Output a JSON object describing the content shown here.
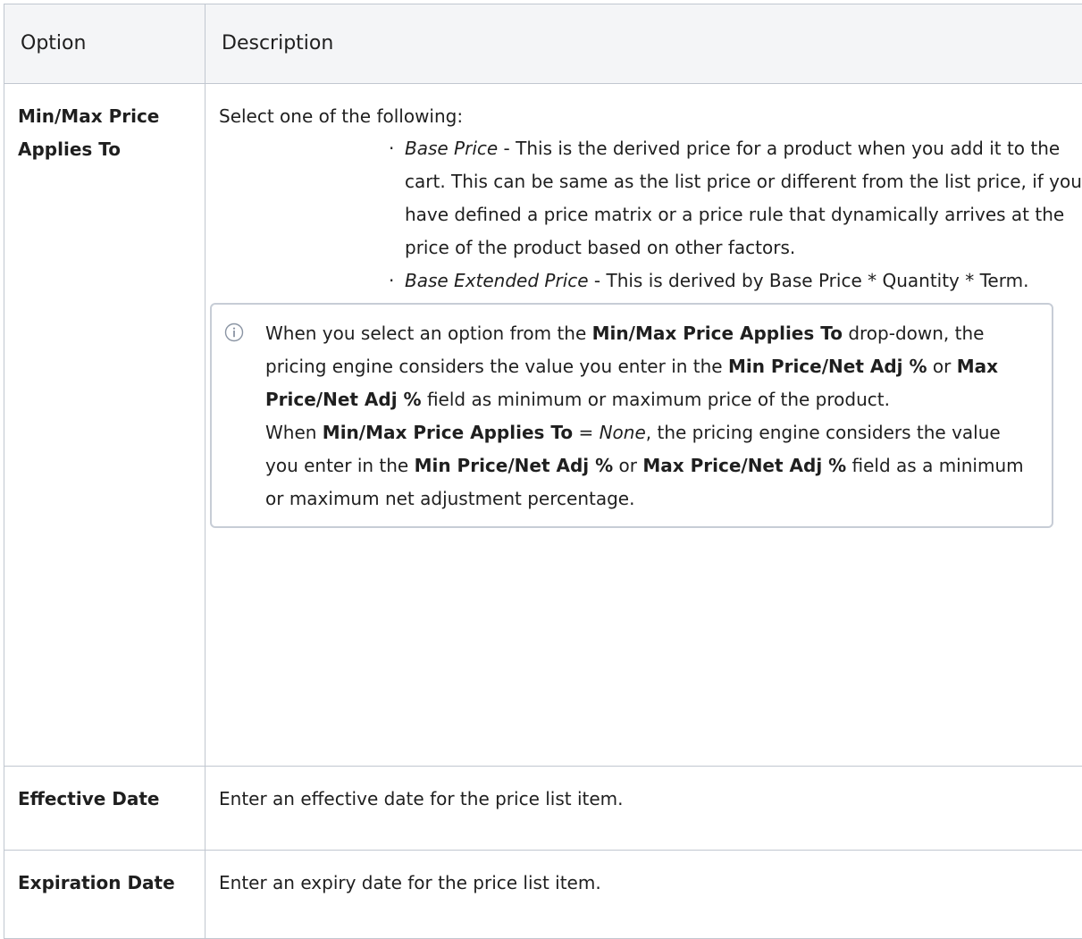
{
  "table": {
    "headers": [
      "Option",
      "Description"
    ],
    "rows": {
      "min_max": {
        "option": "Min/Max Price Applies To",
        "intro": "Select one of the following:",
        "bullets": [
          {
            "term": "Base Price",
            "text": " - This is the derived price for a product when you add it to the cart. This can be same as the list price or different from the list price, if you have defined a price matrix or a price rule that dynamically arrives at the price of the product based on other factors."
          },
          {
            "term": "Base Extended Price",
            "text": " - This is derived by Base Price * Quantity * Term."
          }
        ],
        "note": {
          "icon": "info-icon",
          "p1_a": "When you select an option from the ",
          "p1_b": "Min/Max Price Applies To",
          "p1_c": " drop-down, the pricing engine considers the value you enter in the ",
          "p1_d": "Min Price/Net Adj %",
          "p1_e": " or ",
          "p1_f": "Max Price/Net Adj %",
          "p1_g": " field as minimum or maximum price of the product.",
          "p2_a": "When ",
          "p2_b": "Min/Max Price Applies To",
          "p2_c": " = ",
          "p2_d": "None",
          "p2_e": ", the pricing engine considers the value you enter in the ",
          "p2_f": "Min Price/Net Adj %",
          "p2_g": " or ",
          "p2_h": "Max Price/Net Adj %",
          "p2_i": " field as a minimum or maximum net adjustment percentage."
        }
      },
      "effective": {
        "option": "Effective Date",
        "description": "Enter an effective date for the price list item."
      },
      "expiration": {
        "option": "Expiration Date",
        "description": "Enter an expiry date for the price list item."
      }
    }
  }
}
